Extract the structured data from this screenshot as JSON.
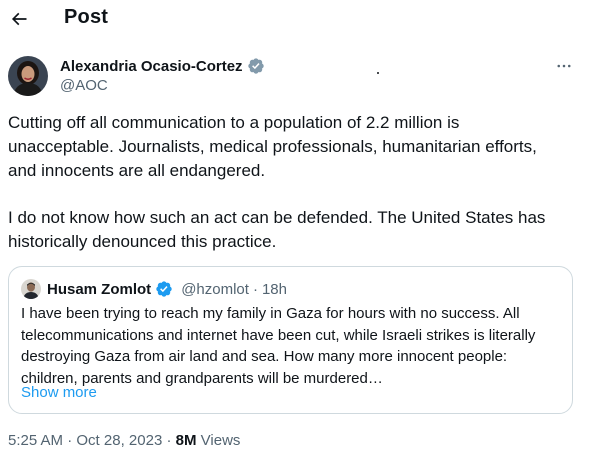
{
  "header": {
    "title": "Post",
    "back_icon": "arrow-left-icon"
  },
  "author": {
    "name": "Alexandria Ocasio-Cortez",
    "handle": "@AOC",
    "verified": true,
    "verified_color": "#1d9bf0"
  },
  "tweet": {
    "paragraphs": [
      [
        "Cutting off all communication to a population of 2.2 million is",
        "unacceptable. Journalists, medical professionals, humanitarian efforts,",
        "and innocents are all endangered."
      ],
      [
        "I do not know how such an act can be defended. The United States has",
        "historically denounced this practice."
      ]
    ]
  },
  "quote": {
    "name": "Husam Zomlot",
    "handle": "@hzomlot",
    "separator": "·",
    "time": "18h",
    "verified": true,
    "lines": [
      "I have been trying to reach my family in Gaza for hours with no success. All",
      "telecommunications and internet have been cut, while Israeli strikes is literally",
      "destroying Gaza from air land and sea. How many more innocent people:",
      "children, parents and grandparents will be murdered…"
    ],
    "show_more": "Show more"
  },
  "meta": {
    "time": "5:25 AM",
    "separator": "·",
    "date": "Oct 28, 2023",
    "views_count": "8M",
    "views_label": "Views"
  },
  "colors": {
    "text": "#0f1419",
    "secondary": "#536471",
    "accent": "#1d9bf0",
    "border": "#cfd9de"
  }
}
